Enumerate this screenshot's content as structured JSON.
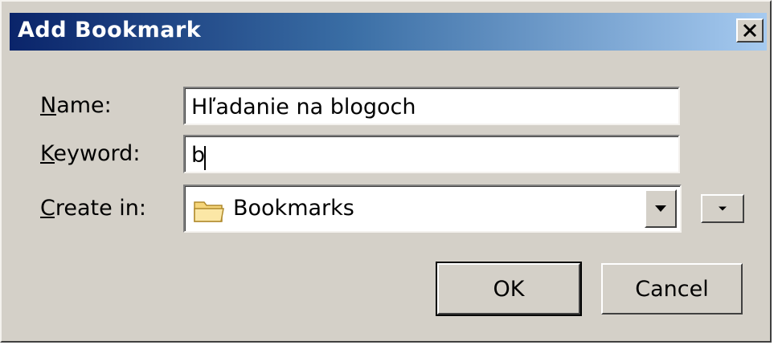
{
  "dialog": {
    "title": "Add Bookmark"
  },
  "form": {
    "name_label": "Name:",
    "name_value": "Hľadanie na blogoch",
    "keyword_label": "Keyword:",
    "keyword_value": "b",
    "create_in_label": "Create in:",
    "create_in_value": "Bookmarks"
  },
  "buttons": {
    "ok_label": "OK",
    "cancel_label": "Cancel"
  },
  "icons": {
    "close": "close-icon",
    "folder": "folder-icon",
    "dropdown": "chevron-down-icon"
  },
  "colors": {
    "titlebar_start": "#0a246a",
    "titlebar_end": "#a6caf0",
    "window_bg": "#d4d0c8"
  }
}
